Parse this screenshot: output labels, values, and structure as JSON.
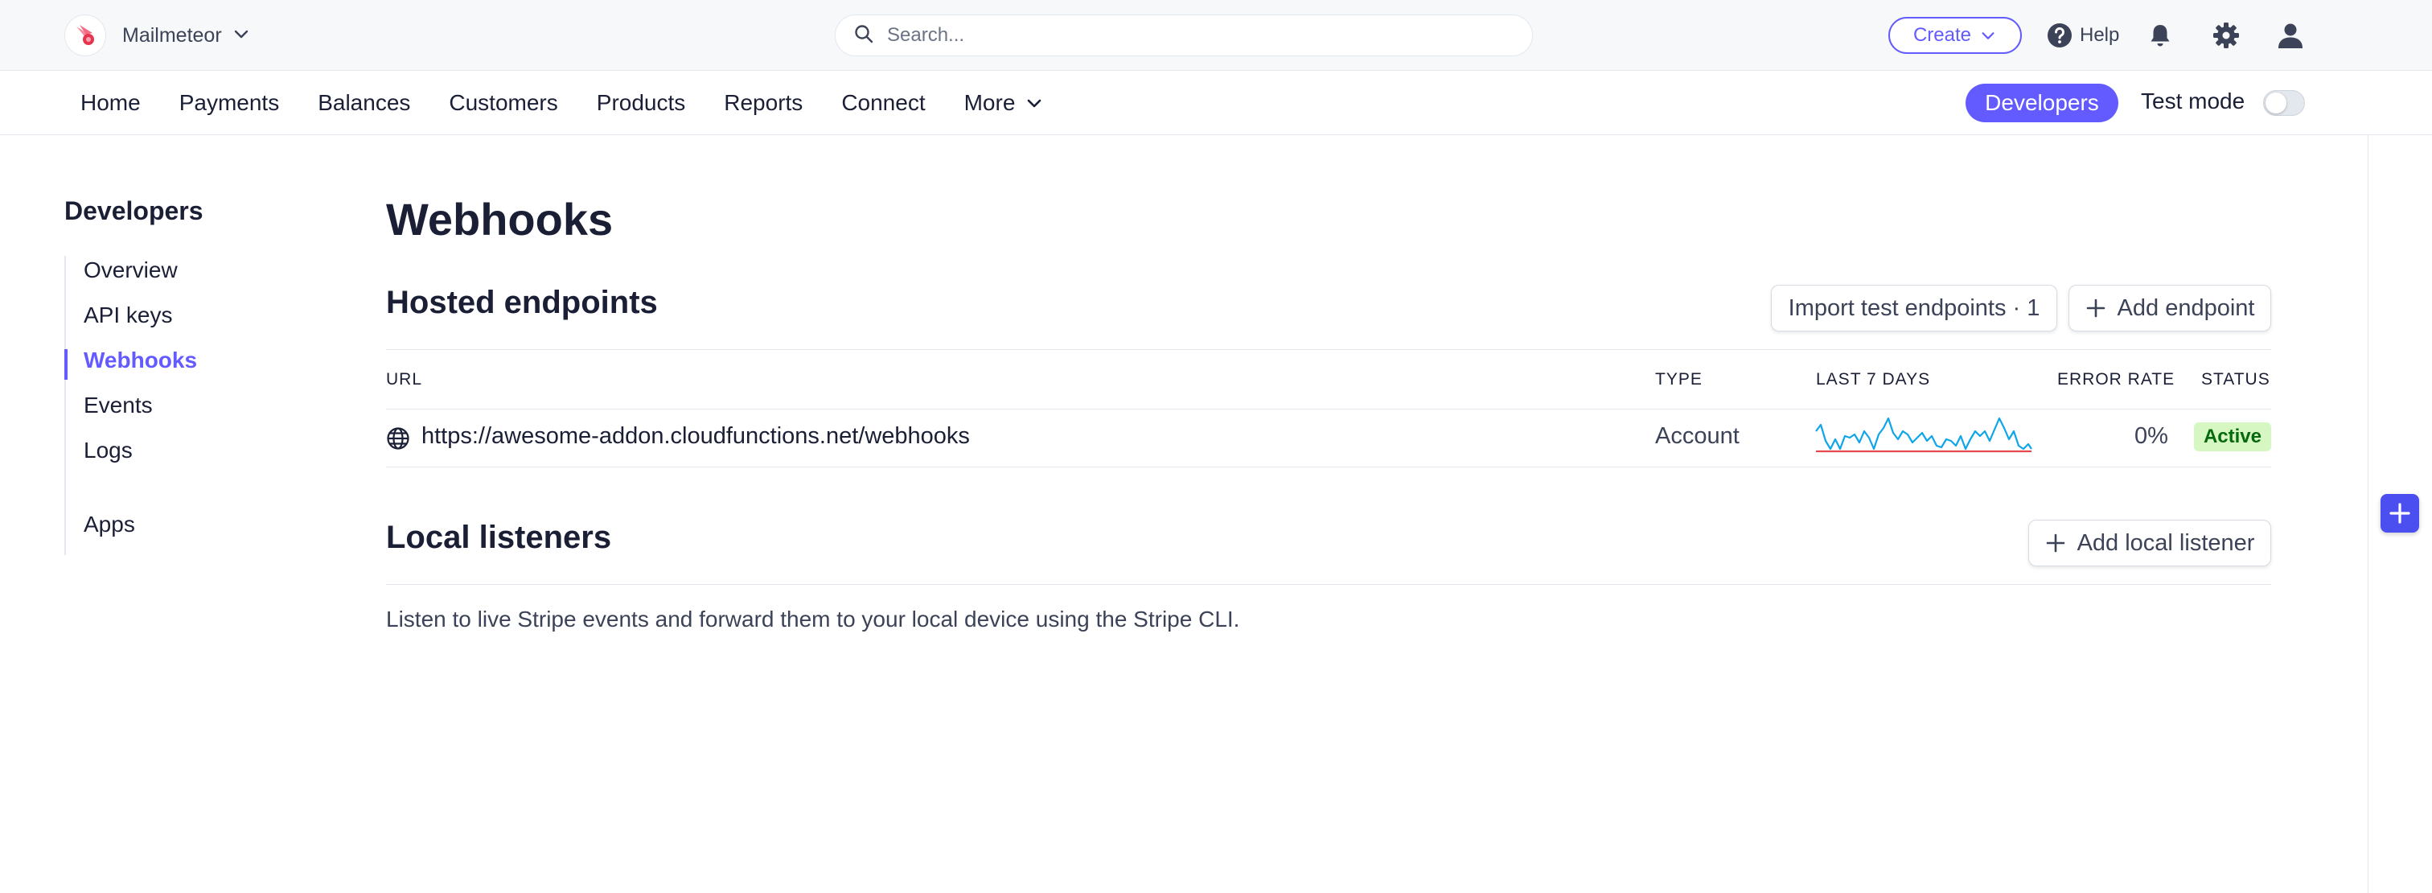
{
  "topbar": {
    "account_name": "Mailmeteor",
    "search_placeholder": "Search...",
    "create_label": "Create",
    "help_label": "Help"
  },
  "nav": {
    "items": [
      "Home",
      "Payments",
      "Balances",
      "Customers",
      "Products",
      "Reports",
      "Connect",
      "More"
    ],
    "developers_label": "Developers",
    "test_mode_label": "Test mode",
    "test_mode_on": false
  },
  "sidebar": {
    "title": "Developers",
    "items": [
      "Overview",
      "API keys",
      "Webhooks",
      "Events",
      "Logs",
      "Apps"
    ],
    "active": "Webhooks"
  },
  "page": {
    "title": "Webhooks",
    "hosted": {
      "title": "Hosted endpoints",
      "import_label": "Import test endpoints · 1",
      "add_label": "Add endpoint",
      "columns": [
        "URL",
        "TYPE",
        "LAST 7 DAYS",
        "ERROR RATE",
        "STATUS"
      ],
      "rows": [
        {
          "url": "https://awesome-addon.cloudfunctions.net/webhooks",
          "type": "Account",
          "error_rate": "0%",
          "status": "Active"
        }
      ]
    },
    "local": {
      "title": "Local listeners",
      "add_label": "Add local listener",
      "description": "Listen to live Stripe events and forward them to your local device using the Stripe CLI."
    }
  },
  "colors": {
    "accent": "#635bff",
    "sparkline_line": "#0fa5e9",
    "sparkline_baseline": "#e5484d",
    "badge_bg": "#d7f7c2",
    "badge_text": "#05690d"
  }
}
